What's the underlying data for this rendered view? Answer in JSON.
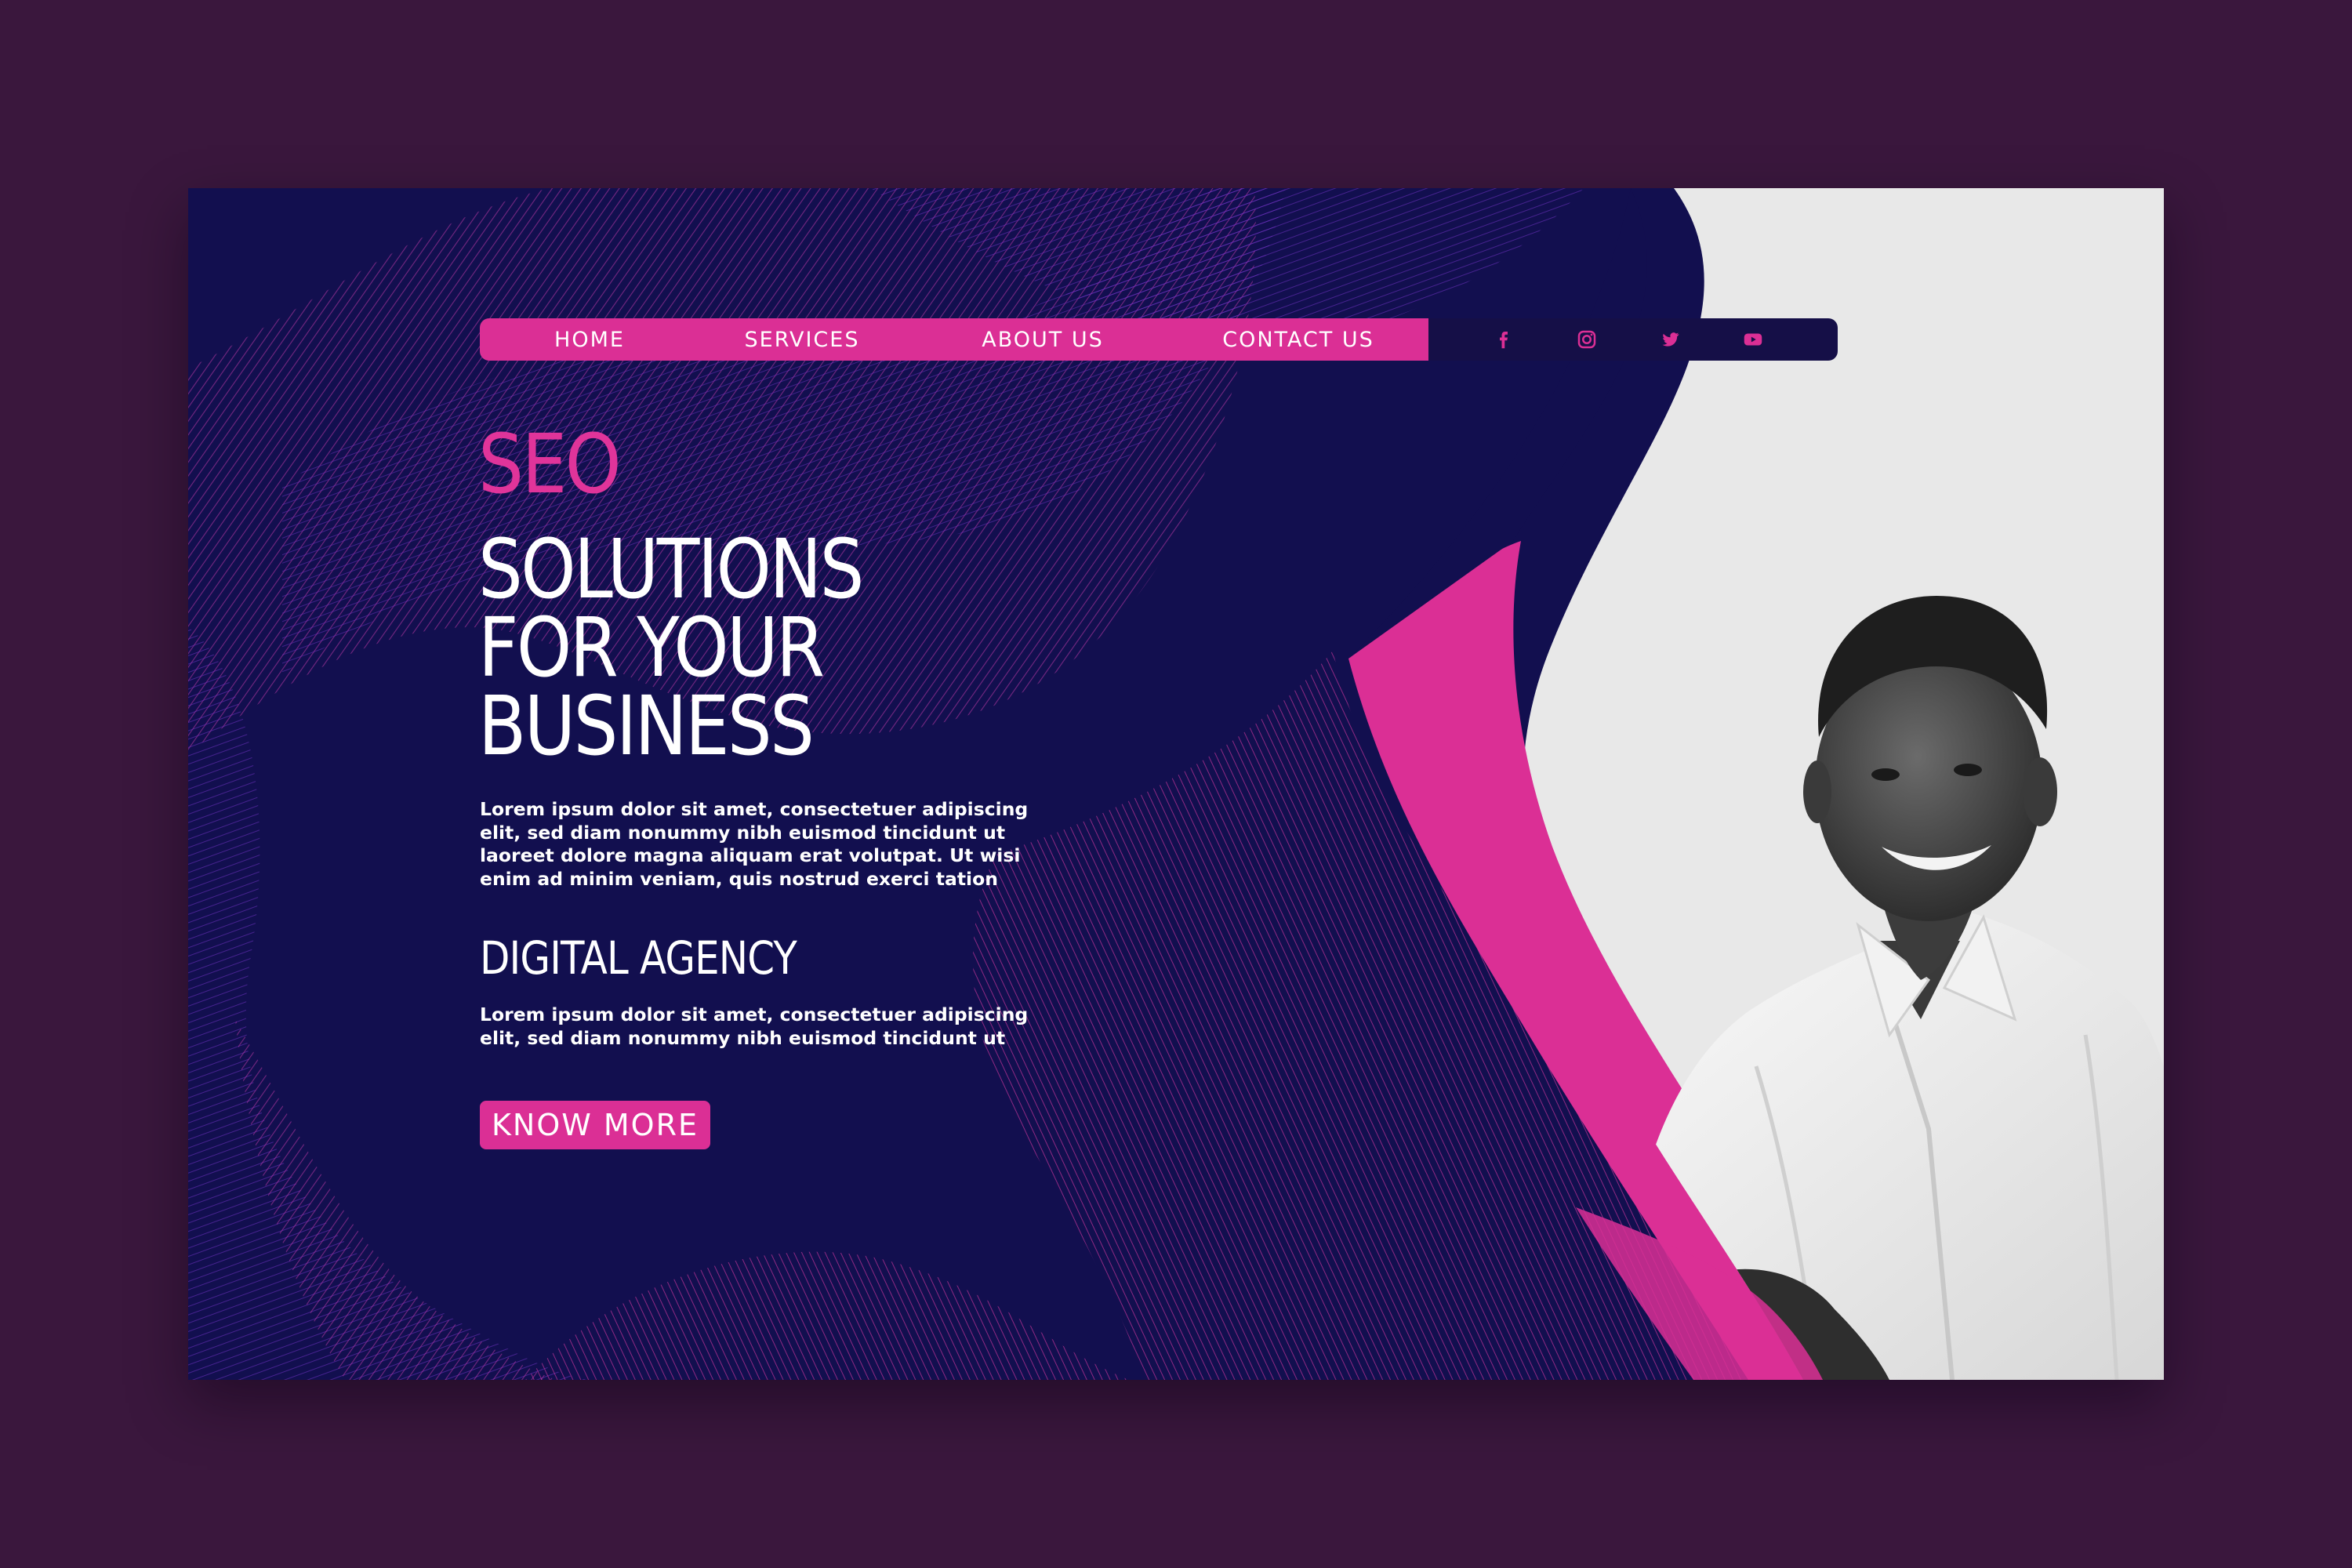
{
  "nav": {
    "items": [
      {
        "label": "HOME"
      },
      {
        "label": "SERVICES"
      },
      {
        "label": "ABOUT US"
      },
      {
        "label": "CONTACT US"
      }
    ],
    "social": [
      "facebook-icon",
      "instagram-icon",
      "twitter-icon",
      "youtube-icon"
    ]
  },
  "hero": {
    "seo": "SEO",
    "title_lines": [
      "SOLUTIONS",
      "FOR YOUR",
      "BUSINESS"
    ],
    "paragraph_1_lines": [
      "Lorem ipsum dolor sit amet, consectetuer adipiscing",
      "elit, sed diam nonummy nibh euismod tincidunt ut",
      "laoreet dolore magna aliquam erat volutpat. Ut wisi",
      "enim ad minim veniam, quis nostrud exerci tation"
    ],
    "subheading": "DIGITAL AGENCY",
    "paragraph_2_lines": [
      "Lorem ipsum dolor sit amet, consectetuer adipiscing",
      "elit, sed diam nonummy nibh euismod tincidunt ut"
    ],
    "cta_label": "KNOW MORE"
  },
  "colors": {
    "page_bg": "#3a173d",
    "navy": "#120f4f",
    "magenta": "#db2f95",
    "photo_bg": "#e6e6e6"
  }
}
